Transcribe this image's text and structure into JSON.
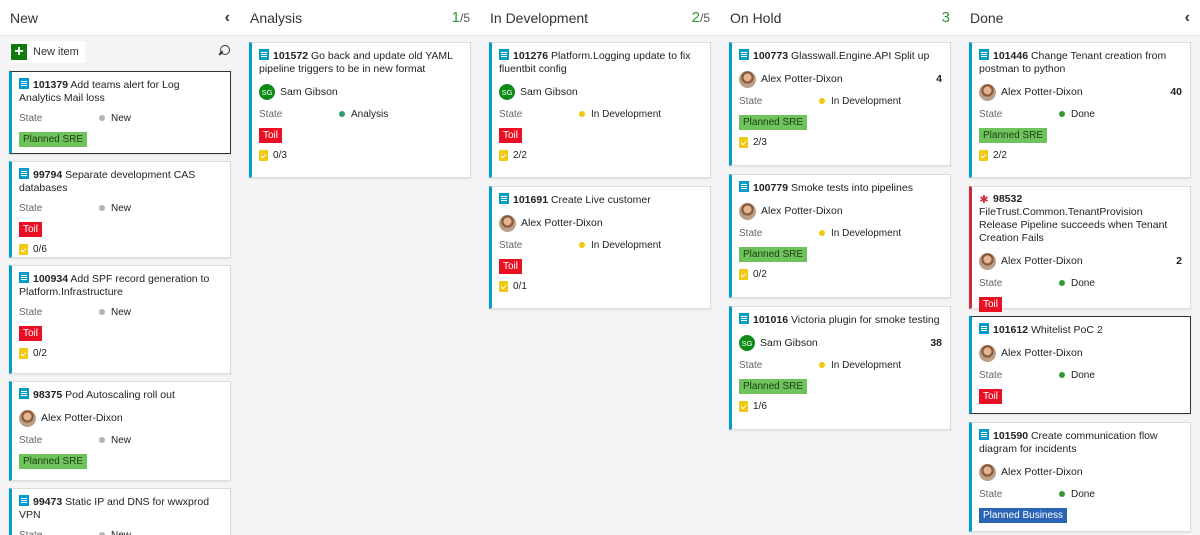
{
  "columns": [
    {
      "title": "New",
      "count": "",
      "den": "",
      "chevron": "‹"
    },
    {
      "title": "Analysis",
      "count": "1",
      "den": "/5"
    },
    {
      "title": "In Development",
      "count": "2",
      "den": "/5"
    },
    {
      "title": "On Hold",
      "count": "3",
      "den": ""
    },
    {
      "title": "Done",
      "count": "",
      "den": "",
      "chevron": "‹"
    }
  ],
  "new_item_label": "New item",
  "state_label": "State",
  "colors": {
    "accent": "#009ccc",
    "bug": "#cc293d",
    "new": "#b3b3b3",
    "analysis": "#339966",
    "in_dev": "#f2c811",
    "done": "#339933"
  },
  "cards": {
    "c101379": {
      "id": "101379",
      "title": "Add teams alert for Log Analytics Mail loss",
      "state": "New",
      "tag": "Planned SRE"
    },
    "c99794": {
      "id": "99794",
      "title": "Separate development CAS databases",
      "state": "New",
      "tag": "Toil",
      "tasks": "0/6"
    },
    "c100934": {
      "id": "100934",
      "title": "Add SPF record generation to Platform.Infrastructure",
      "state": "New",
      "tag": "Toil",
      "tasks": "0/2"
    },
    "c98375": {
      "id": "98375",
      "title": "Pod Autoscaling roll out",
      "assignee": "Alex Potter-Dixon",
      "state": "New",
      "tag": "Planned SRE"
    },
    "c99473": {
      "id": "99473",
      "title": "Static IP and DNS for wwxprod VPN",
      "state": "New"
    },
    "c101572": {
      "id": "101572",
      "title": "Go back and update old YAML pipeline triggers to be in new format",
      "assignee": "Sam Gibson",
      "initials": "SG",
      "state": "Analysis",
      "tag": "Toil",
      "tasks": "0/3"
    },
    "c101276": {
      "id": "101276",
      "title": "Platform.Logging update to fix fluentbit config",
      "assignee": "Sam Gibson",
      "initials": "SG",
      "state": "In Development",
      "tag": "Toil",
      "tasks": "2/2"
    },
    "c101691": {
      "id": "101691",
      "title": "Create Live customer",
      "assignee": "Alex Potter-Dixon",
      "state": "In Development",
      "tag": "Toil",
      "tasks": "0/1"
    },
    "c100773": {
      "id": "100773",
      "title": "Glasswall.Engine.API Split up",
      "assignee": "Alex Potter-Dixon",
      "effort": "4",
      "state": "In Development",
      "tag": "Planned SRE",
      "tasks": "2/3"
    },
    "c100779": {
      "id": "100779",
      "title": "Smoke tests into pipelines",
      "assignee": "Alex Potter-Dixon",
      "state": "In Development",
      "tag": "Planned SRE",
      "tasks": "0/2"
    },
    "c101016": {
      "id": "101016",
      "title": "Victoria plugin for smoke testing",
      "assignee": "Sam Gibson",
      "initials": "SG",
      "effort": "38",
      "state": "In Development",
      "tag": "Planned SRE",
      "tasks": "1/6"
    },
    "c101446": {
      "id": "101446",
      "title": "Change Tenant creation from postman to python",
      "assignee": "Alex Potter-Dixon",
      "effort": "40",
      "state": "Done",
      "tag": "Planned SRE",
      "tasks": "2/2"
    },
    "c98532": {
      "id": "98532",
      "title": "FileTrust.Common.TenantProvision Release Pipeline succeeds when Tenant Creation Fails",
      "assignee": "Alex Potter-Dixon",
      "effort": "2",
      "state": "Done",
      "tag": "Toil"
    },
    "c101612": {
      "id": "101612",
      "title": "Whitelist PoC 2",
      "assignee": "Alex Potter-Dixon",
      "state": "Done",
      "tag": "Toil"
    },
    "c101590": {
      "id": "101590",
      "title": "Create communication flow diagram for incidents",
      "assignee": "Alex Potter-Dixon",
      "state": "Done",
      "tag": "Planned Business"
    }
  }
}
